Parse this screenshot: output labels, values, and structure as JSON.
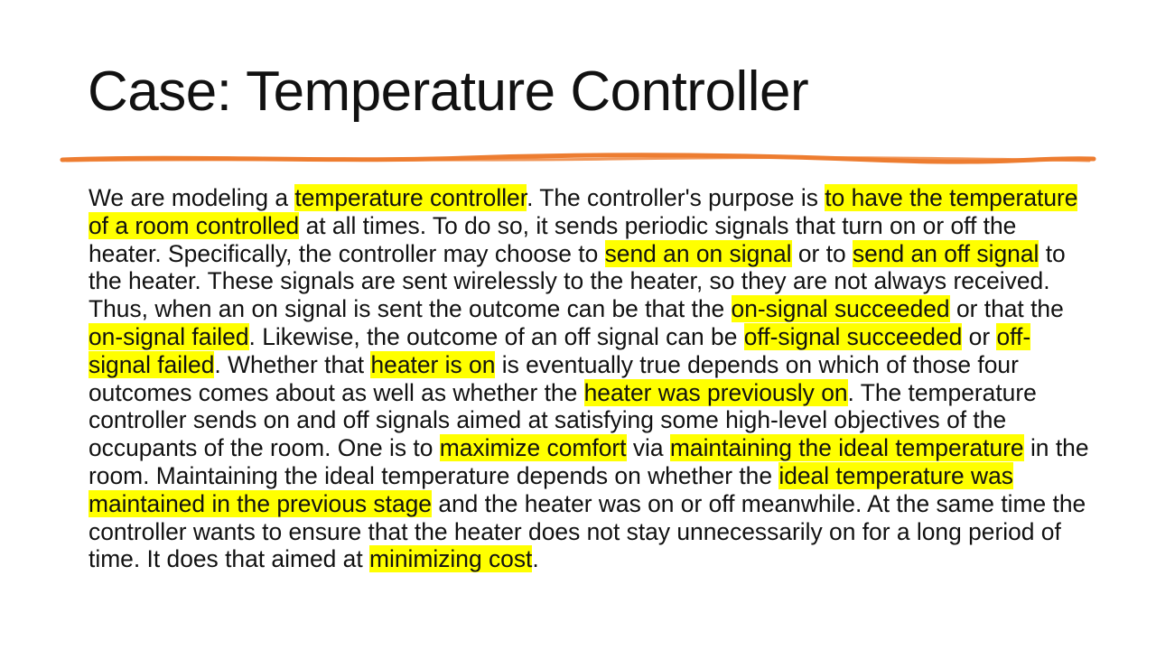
{
  "slide": {
    "title": "Case: Temperature Controller",
    "accent_color": "#ed7d31",
    "highlight_color": "#ffff00",
    "body": [
      {
        "text": "We are modeling a ",
        "highlight": false
      },
      {
        "text": "temperature controller",
        "highlight": true
      },
      {
        "text": ". The controller's purpose is ",
        "highlight": false
      },
      {
        "text": "to have the temperature of a room controlled",
        "highlight": true
      },
      {
        "text": " at all times. To do so, it sends periodic signals that turn on or off the heater. Specifically, the controller may choose to ",
        "highlight": false
      },
      {
        "text": "send an on signal",
        "highlight": true
      },
      {
        "text": " or to ",
        "highlight": false
      },
      {
        "text": "send an off signal",
        "highlight": true
      },
      {
        "text": " to the heater. These signals are sent wirelessly to the heater, so they are not always received. Thus, when an on signal is sent the outcome can be that the ",
        "highlight": false
      },
      {
        "text": "on-signal succeeded",
        "highlight": true
      },
      {
        "text": " or that the ",
        "highlight": false
      },
      {
        "text": "on-signal failed",
        "highlight": true
      },
      {
        "text": ". Likewise, the outcome of an off signal can be ",
        "highlight": false
      },
      {
        "text": "off-signal succeeded",
        "highlight": true
      },
      {
        "text": " or ",
        "highlight": false
      },
      {
        "text": "off-signal failed",
        "highlight": true
      },
      {
        "text": ". Whether that ",
        "highlight": false
      },
      {
        "text": "heater is on",
        "highlight": true
      },
      {
        "text": " is eventually true depends on which of those four outcomes comes about as well as whether the ",
        "highlight": false
      },
      {
        "text": "heater was previously on",
        "highlight": true
      },
      {
        "text": ". The temperature controller sends on and off signals aimed at satisfying some high-level objectives of the occupants of the room. One is to ",
        "highlight": false
      },
      {
        "text": "maximize comfort",
        "highlight": true
      },
      {
        "text": " via ",
        "highlight": false
      },
      {
        "text": "maintaining the ideal temperature",
        "highlight": true
      },
      {
        "text": " in the room. Maintaining the ideal temperature depends on whether the ",
        "highlight": false
      },
      {
        "text": "ideal temperature was maintained in the previous stage",
        "highlight": true
      },
      {
        "text": " and the heater was on or off meanwhile. At the same time the controller wants to ensure that the heater does not stay unnecessarily on for a long period of time. It does that aimed at ",
        "highlight": false
      },
      {
        "text": "minimizing cost",
        "highlight": true
      },
      {
        "text": ".",
        "highlight": false
      }
    ]
  }
}
